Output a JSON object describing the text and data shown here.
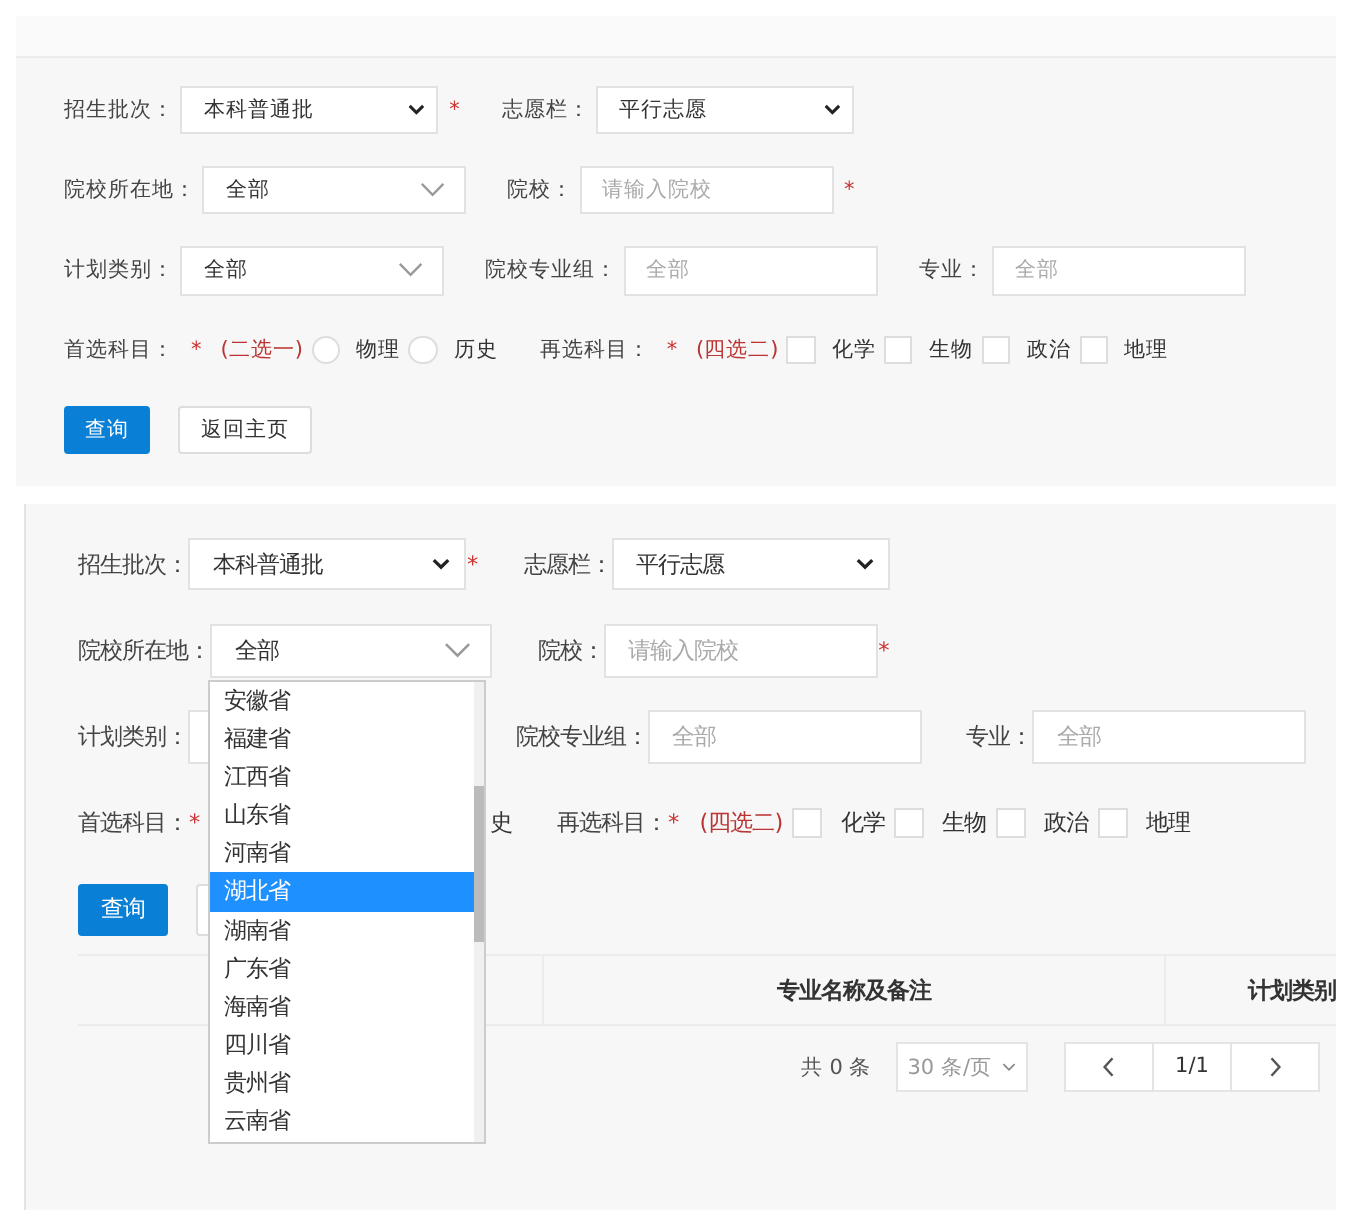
{
  "panels": [
    {
      "kind": "form",
      "rows": [
        [
          [
            {
              "kind": "label",
              "text": "招生批次："
            },
            {
              "kind": "native-select",
              "value": "本科普通批"
            },
            {
              "kind": "star",
              "text": "*"
            }
          ],
          [
            {
              "kind": "label",
              "text": "志愿栏："
            },
            {
              "kind": "native-select",
              "value": "平行志愿"
            }
          ]
        ],
        [
          [
            {
              "kind": "label",
              "text": "院校所在地："
            },
            {
              "kind": "select",
              "value": "全部"
            }
          ],
          [
            {
              "kind": "label",
              "text": "院校："
            },
            {
              "kind": "input",
              "placeholder": "请输入院校"
            },
            {
              "kind": "star",
              "text": "*"
            }
          ]
        ],
        [
          [
            {
              "kind": "label",
              "text": "计划类别："
            },
            {
              "kind": "select",
              "value": "全部"
            }
          ],
          [
            {
              "kind": "label",
              "text": "院校专业组："
            },
            {
              "kind": "input",
              "placeholder": "全部"
            }
          ],
          [
            {
              "kind": "label",
              "text": "专业："
            },
            {
              "kind": "input",
              "placeholder": "全部"
            }
          ]
        ],
        [
          [
            {
              "kind": "label",
              "text": "首选科目："
            },
            {
              "kind": "star",
              "text": "*"
            },
            {
              "kind": "hint",
              "text": "(二选一)"
            },
            {
              "kind": "radio",
              "label": "物理",
              "checked": false
            },
            {
              "kind": "radio",
              "label": "历史",
              "checked": false
            }
          ],
          [
            {
              "kind": "label",
              "text": "再选科目："
            },
            {
              "kind": "star",
              "text": "*"
            },
            {
              "kind": "hint",
              "text": "(四选二)"
            },
            {
              "kind": "checkbox",
              "label": "化学",
              "checked": false
            },
            {
              "kind": "checkbox",
              "label": "生物",
              "checked": false
            },
            {
              "kind": "checkbox",
              "label": "政治",
              "checked": false
            },
            {
              "kind": "checkbox",
              "label": "地理",
              "checked": false
            }
          ]
        ]
      ],
      "buttons": [
        {
          "kind": "primary",
          "label": "查询"
        },
        {
          "kind": "default",
          "label": "返回主页"
        }
      ]
    },
    {
      "kind": "results",
      "rows": [
        [
          [
            {
              "kind": "label",
              "text": "招生批次："
            },
            {
              "kind": "native-select",
              "value": "本科普通批"
            },
            {
              "kind": "star",
              "text": "*"
            }
          ],
          [
            {
              "kind": "label",
              "text": "志愿栏："
            },
            {
              "kind": "native-select",
              "value": "平行志愿"
            }
          ]
        ],
        [
          [
            {
              "kind": "label",
              "text": "院校所在地："
            },
            {
              "kind": "select",
              "value": "全部"
            }
          ],
          [
            {
              "kind": "label",
              "text": "院校："
            },
            {
              "kind": "input",
              "placeholder": "请输入院校"
            },
            {
              "kind": "star",
              "text": "*"
            }
          ]
        ],
        [
          [
            {
              "kind": "label",
              "text": "计划类别："
            },
            {
              "kind": "select"
            }
          ],
          [
            {
              "kind": "label",
              "text": "院校专业组："
            },
            {
              "kind": "input",
              "placeholder": "全部"
            }
          ],
          [
            {
              "kind": "label",
              "text": "专业："
            },
            {
              "kind": "input",
              "placeholder": "全部"
            }
          ]
        ],
        [
          [
            {
              "kind": "label",
              "text": "首选科目："
            },
            {
              "kind": "star",
              "text": "*"
            },
            {
              "kind": "fragment",
              "text": "史"
            }
          ],
          [
            {
              "kind": "label",
              "text": "再选科目："
            },
            {
              "kind": "star",
              "text": "*"
            },
            {
              "kind": "hint",
              "text": "(四选二)"
            },
            {
              "kind": "checkbox",
              "label": "化学",
              "checked": false
            },
            {
              "kind": "checkbox",
              "label": "生物",
              "checked": false
            },
            {
              "kind": "checkbox",
              "label": "政治",
              "checked": false
            },
            {
              "kind": "checkbox",
              "label": "地理",
              "checked": false
            }
          ]
        ]
      ],
      "buttons": [
        {
          "kind": "primary",
          "label": "查询"
        },
        {
          "kind": "default"
        }
      ],
      "dropdown": {
        "options": [
          {
            "label": "安徽省",
            "selected": false
          },
          {
            "label": "福建省",
            "selected": false
          },
          {
            "label": "江西省",
            "selected": false
          },
          {
            "label": "山东省",
            "selected": false
          },
          {
            "label": "河南省",
            "selected": false
          },
          {
            "label": "湖北省",
            "selected": true
          },
          {
            "label": "湖南省",
            "selected": false
          },
          {
            "label": "广东省",
            "selected": false
          },
          {
            "label": "海南省",
            "selected": false
          },
          {
            "label": "四川省",
            "selected": false
          },
          {
            "label": "贵州省",
            "selected": false
          },
          {
            "label": "云南省",
            "selected": false
          }
        ]
      },
      "table": {
        "columns": [
          "专业名称及备注",
          "计划类别"
        ]
      },
      "pagination": {
        "total": "共 0 条",
        "page_size": "30 条/页",
        "page": "1/1"
      }
    }
  ]
}
